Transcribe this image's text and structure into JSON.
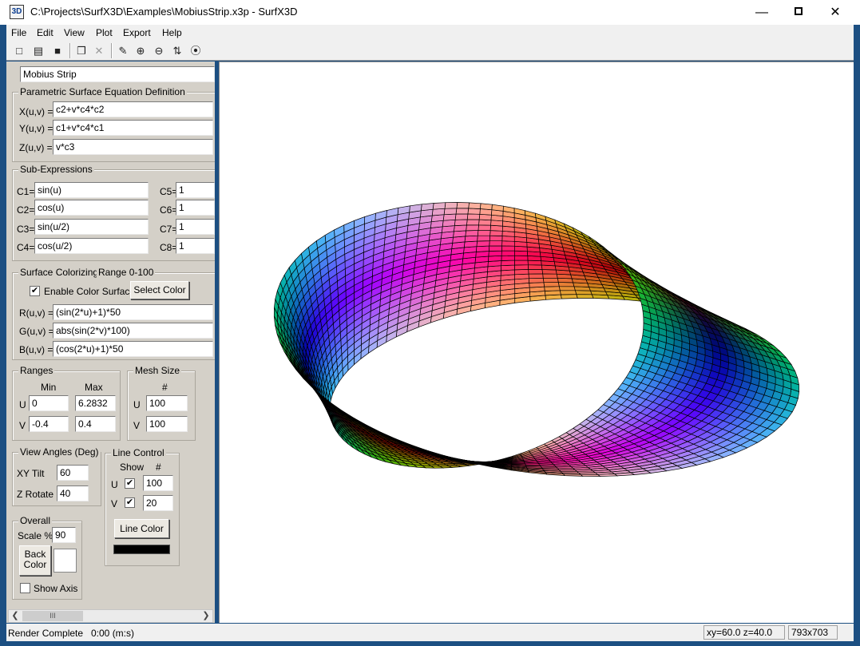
{
  "window": {
    "title": "C:\\Projects\\SurfX3D\\Examples\\MobiusStrip.x3p - SurfX3D",
    "app_icon_text": "3D",
    "minimize_glyph": "—",
    "close_glyph": "✕"
  },
  "menu": [
    "File",
    "Edit",
    "View",
    "Plot",
    "Export",
    "Help"
  ],
  "toolbar": {
    "icons": [
      "new-icon",
      "open-icon",
      "save-icon",
      "copy-icon",
      "delete-icon",
      "pencil-icon",
      "zoom-in-icon",
      "zoom-out-icon",
      "fit-vertical-icon",
      "rotate-icon"
    ],
    "glyphs": [
      "□",
      "▤",
      "■",
      "❐",
      "✕",
      "✎",
      "⊕",
      "⊖",
      "⇅",
      "⦿"
    ]
  },
  "surface_name": "Mobius Strip",
  "equations": {
    "title": "Parametric Surface Equation Definition",
    "x_label": "X(u,v) =",
    "x_value": "c2+v*c4*c2",
    "y_label": "Y(u,v) =",
    "y_value": "c1+v*c4*c1",
    "z_label": "Z(u,v) =",
    "z_value": "v*c3"
  },
  "subexpr": {
    "title": "Sub-Expressions",
    "c1_label": "C1=",
    "c1": "sin(u)",
    "c2_label": "C2=",
    "c2": "cos(u)",
    "c3_label": "C3=",
    "c3": "sin(u/2)",
    "c4_label": "C4=",
    "c4": "cos(u/2)",
    "c5_label": "C5=",
    "c5": "1",
    "c6_label": "C6=",
    "c6": "1",
    "c7_label": "C7=",
    "c7": "1",
    "c8_label": "C8=",
    "c8": "1"
  },
  "colorize": {
    "title": "Surface Colorizing",
    "range": "Range 0-100",
    "enable_label": "Enable Color Surface",
    "enable_checked": true,
    "select_color": "Select Color",
    "r_label": "R(u,v) =",
    "r_value": "(sin(2*u)+1)*50",
    "g_label": "G(u,v) =",
    "g_value": "abs(sin(2*v)*100)",
    "b_label": "B(u,v) =",
    "b_value": "(cos(2*u)+1)*50"
  },
  "ranges": {
    "title": "Ranges",
    "min_label": "Min",
    "max_label": "Max",
    "u_label": "U",
    "u_min": "0",
    "u_max": "6.2832",
    "v_label": "V",
    "v_min": "-0.4",
    "v_max": "0.4"
  },
  "mesh": {
    "title": "Mesh Size",
    "hash_label": "#",
    "u_label": "U",
    "u_value": "100",
    "v_label": "V",
    "v_value": "100"
  },
  "view_angles": {
    "title": "View Angles (Deg)",
    "xy_label": "XY Tilt",
    "xy_value": "60",
    "z_label": "Z Rotate",
    "z_value": "40"
  },
  "line_control": {
    "title": "Line Control",
    "show_label": "Show",
    "hash_label": "#",
    "u_label": "U",
    "u_checked": true,
    "u_value": "100",
    "v_label": "V",
    "v_checked": true,
    "v_value": "20",
    "line_color_button": "Line Color",
    "line_color": "#000000"
  },
  "overall": {
    "title": "Overall",
    "scale_label": "Scale %",
    "scale_value": "90",
    "back_color_line1": "Back",
    "back_color_line2": "Color",
    "back_color": "#ffffff",
    "show_axis_label": "Show Axis",
    "show_axis_checked": false
  },
  "scrollbar": {
    "left": "❮",
    "right": "❯",
    "thumb": "III"
  },
  "status": {
    "message": "Render Complete",
    "time": "0:00 (m:s)",
    "angles": "xy=60.0 z=40.0",
    "size": "793x703"
  },
  "colors": {
    "titlebar": "#ffffff",
    "window_border": "#1c4f82",
    "panel": "#d4d0c8",
    "mesh_line": "#000000"
  }
}
